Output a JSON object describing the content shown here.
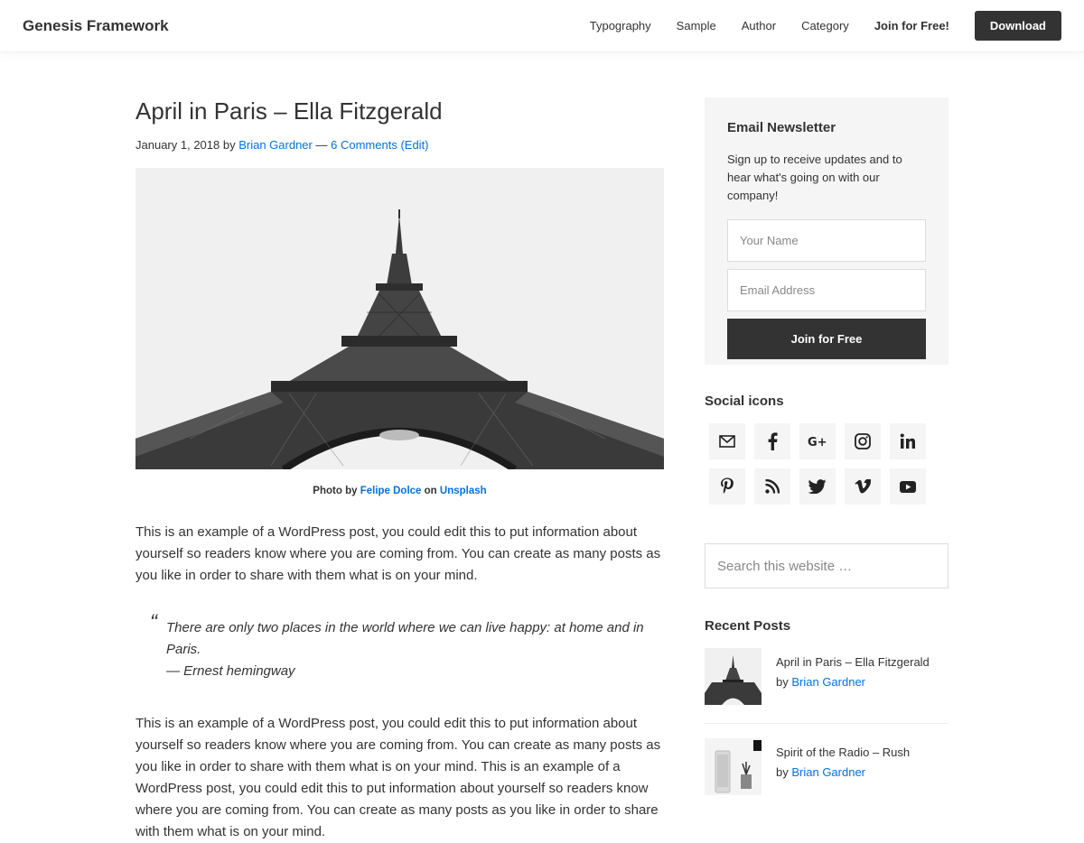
{
  "header": {
    "site_title": "Genesis Framework",
    "nav": [
      "Typography",
      "Sample",
      "Author",
      "Category",
      "Join for Free!"
    ],
    "download_label": "Download"
  },
  "post": {
    "title": "April in Paris – Ella Fitzgerald",
    "date": "January 1, 2018",
    "by": "by",
    "author": "Brian Gardner",
    "separator": "—",
    "comments": "6 Comments",
    "edit": "(Edit)",
    "caption_prefix": "Photo by",
    "caption_author": "Felipe Dolce",
    "caption_on": "on",
    "caption_source": "Unsplash",
    "paragraph1": "This is an example of a WordPress post, you could edit this to put information about yourself so readers know where you are coming from. You can create as many posts as you like in order to share with them what is on your mind.",
    "quote_mark": "“",
    "quote_text": "There are only two places in the world where we can live happy: at home and in Paris.",
    "quote_cite": "— Ernest hemingway",
    "paragraph2": "This is an example of a WordPress post, you could edit this to put information about yourself so readers know where you are coming from. You can create as many posts as you like in order to share with them what is on your mind. This is an example of a WordPress post, you could edit this to put information about yourself so readers know where you are coming from. You can create as many posts as you like in order to share with them what is on your mind."
  },
  "sidebar": {
    "newsletter_title": "Email Newsletter",
    "newsletter_text": "Sign up to receive updates and to hear what's going on with our company!",
    "name_placeholder": "Your Name",
    "email_placeholder": "Email Address",
    "join_label": "Join for Free",
    "social_title": "Social icons",
    "social_icons": [
      "email-icon",
      "facebook-icon",
      "google-plus-icon",
      "instagram-icon",
      "linkedin-icon",
      "pinterest-icon",
      "rss-icon",
      "twitter-icon",
      "vimeo-icon",
      "youtube-icon"
    ],
    "search_placeholder": "Search this website …",
    "recent_title": "Recent Posts",
    "recent": [
      {
        "title": "April in Paris – Ella Fitzgerald",
        "by": "by",
        "author": "Brian Gardner"
      },
      {
        "title": "Spirit of the Radio – Rush",
        "by": "by",
        "author": "Brian Gardner"
      }
    ]
  },
  "colors": {
    "link": "#0073e5",
    "button": "#333333",
    "panel": "#f5f5f5"
  }
}
